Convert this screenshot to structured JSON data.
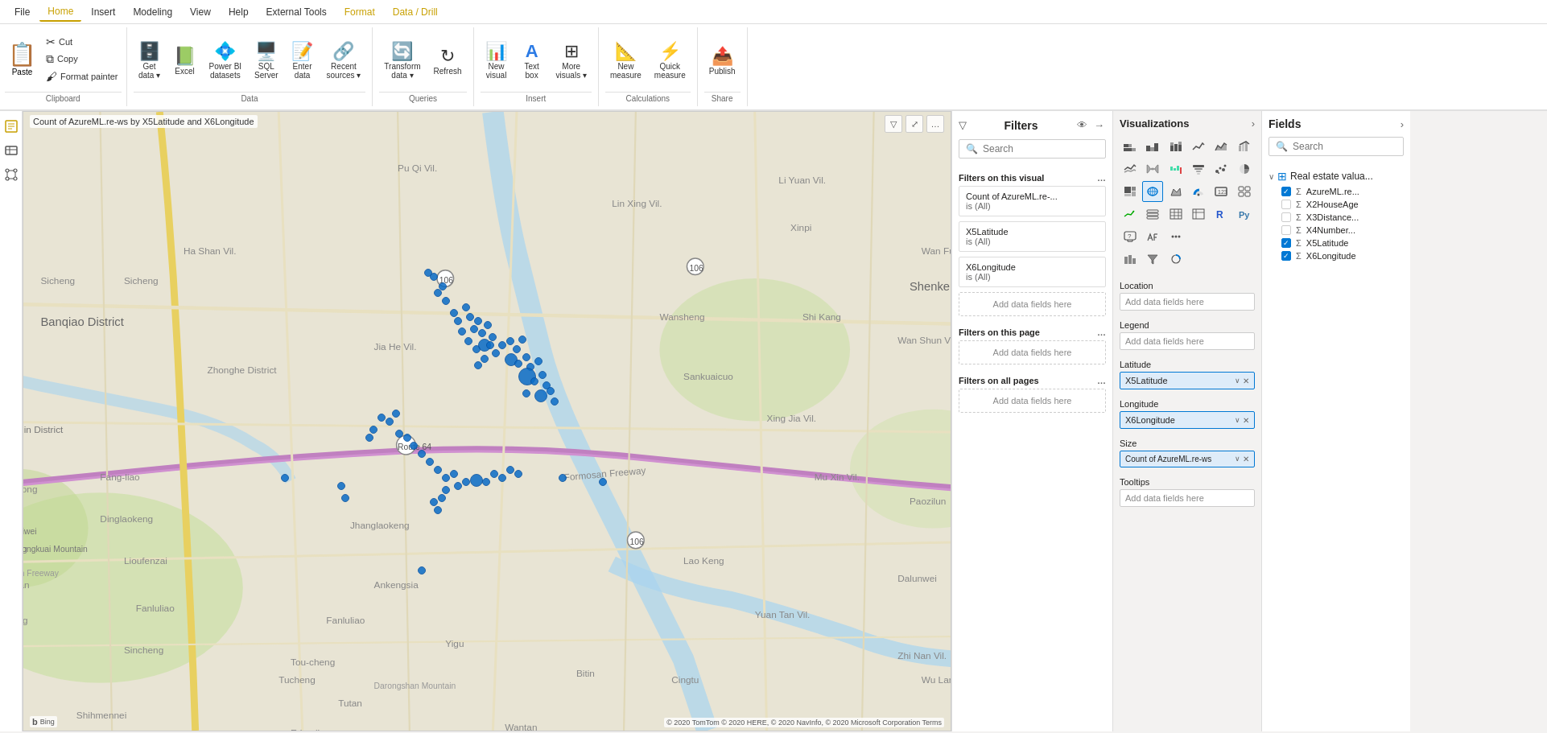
{
  "menu": {
    "items": [
      {
        "label": "File",
        "id": "file"
      },
      {
        "label": "Home",
        "id": "home",
        "active": true
      },
      {
        "label": "Insert",
        "id": "insert"
      },
      {
        "label": "Modeling",
        "id": "modeling"
      },
      {
        "label": "View",
        "id": "view"
      },
      {
        "label": "Help",
        "id": "help"
      },
      {
        "label": "External Tools",
        "id": "external-tools"
      },
      {
        "label": "Format",
        "id": "format",
        "activeGold": true
      },
      {
        "label": "Data / Drill",
        "id": "data-drill",
        "activeGold": true
      }
    ]
  },
  "ribbon": {
    "sections": [
      {
        "id": "clipboard",
        "label": "Clipboard",
        "buttons_small": [
          "Paste",
          "Cut",
          "Copy",
          "Format painter"
        ]
      },
      {
        "id": "data",
        "label": "Data",
        "buttons": [
          {
            "icon": "🗄️",
            "label": "Get\ndata",
            "has_arrow": true
          },
          {
            "icon": "📗",
            "label": "Excel"
          },
          {
            "icon": "💠",
            "label": "Power BI\ndatasets"
          },
          {
            "icon": "🖥️",
            "label": "SQL\nServer"
          },
          {
            "icon": "📝",
            "label": "Enter\ndata"
          },
          {
            "icon": "🔗",
            "label": "Recent\nsources",
            "has_arrow": true
          }
        ]
      },
      {
        "id": "queries",
        "label": "Queries",
        "buttons": [
          {
            "icon": "🔄",
            "label": "Transform\ndata",
            "has_arrow": true
          },
          {
            "icon": "↻",
            "label": "Refresh"
          }
        ]
      },
      {
        "id": "insert",
        "label": "Insert",
        "buttons": [
          {
            "icon": "📊",
            "label": "New\nvisual"
          },
          {
            "icon": "T",
            "label": "Text\nbox"
          },
          {
            "icon": "⊞",
            "label": "More\nvisuals",
            "has_arrow": true
          }
        ]
      },
      {
        "id": "calculations",
        "label": "Calculations",
        "buttons": [
          {
            "icon": "📐",
            "label": "New\nmeasure"
          },
          {
            "icon": "⚡",
            "label": "Quick\nmeasure"
          }
        ]
      },
      {
        "id": "share",
        "label": "Share",
        "buttons": [
          {
            "icon": "📤",
            "label": "Publish"
          }
        ]
      }
    ]
  },
  "map": {
    "title": "Count of AzureML.re-ws by X5Latitude and X6Longitude",
    "attribution": "b Bing",
    "copyright": "© 2020 TomTom © 2020 HERE, © 2020 NavInfo, © 2020 Microsoft Corporation Terms"
  },
  "filters": {
    "title": "Filters",
    "search_placeholder": "Search",
    "sections": [
      {
        "title": "Filters on this visual",
        "cards": [
          {
            "title": "Count of AzureML.re-...",
            "value": "is (All)"
          },
          {
            "title": "X5Latitude",
            "value": "is (All)"
          },
          {
            "title": "X6Longitude",
            "value": "is (All)"
          }
        ],
        "add_label": "Add data fields here"
      },
      {
        "title": "Filters on this page",
        "add_label": "Add data fields here"
      },
      {
        "title": "Filters on all pages",
        "add_label": "Add data fields here"
      }
    ]
  },
  "visualizations": {
    "title": "Visualizations",
    "fields": [
      {
        "label": "Location",
        "placeholder": "Add data fields here"
      },
      {
        "label": "Legend",
        "placeholder": "Add data fields here"
      },
      {
        "label": "Latitude",
        "value": "X5Latitude",
        "filled": true
      },
      {
        "label": "Longitude",
        "value": "X6Longitude",
        "filled": true
      },
      {
        "label": "Size",
        "value": "Count of AzureML.re-ws",
        "filled": true
      },
      {
        "label": "Tooltips",
        "placeholder": "Add data fields here"
      }
    ]
  },
  "fields": {
    "title": "Fields",
    "search_placeholder": "Search",
    "groups": [
      {
        "name": "Real estate valua...",
        "items": [
          {
            "name": "AzureML.re...",
            "checked": true
          },
          {
            "name": "X2HouseAge",
            "checked": false
          },
          {
            "name": "X3Distance...",
            "checked": false
          },
          {
            "name": "X4Number...",
            "checked": false
          },
          {
            "name": "X5Latitude",
            "checked": true
          },
          {
            "name": "X6Longitude",
            "checked": true
          }
        ]
      }
    ]
  },
  "icons": {
    "cut": "✂",
    "copy": "⧉",
    "paste": "📋",
    "format_painter": "🖌",
    "filter": "▽",
    "search": "🔍",
    "chevron_right": "›",
    "chevron_down": "∨",
    "dots": "...",
    "eye": "👁",
    "arrow_right": "→",
    "expand": "⤢",
    "close": "✕",
    "checkmark": "✓"
  }
}
